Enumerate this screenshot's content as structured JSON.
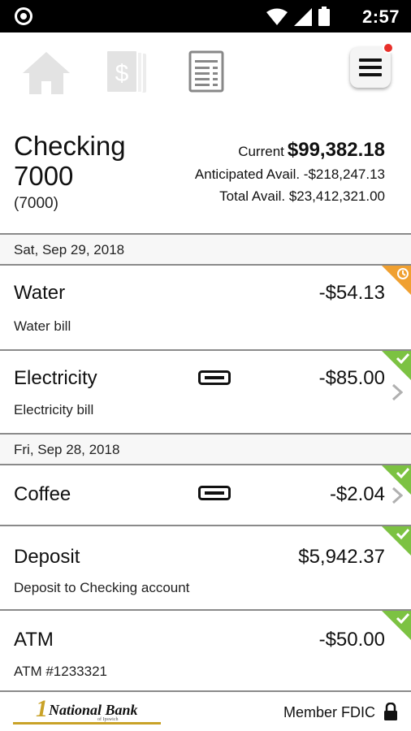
{
  "status_bar": {
    "time": "2:57",
    "icons": [
      "screen-record-icon",
      "wifi-icon",
      "cell-signal-icon",
      "battery-icon"
    ]
  },
  "nav": {
    "icons": [
      "home-icon",
      "money-icon",
      "statements-icon",
      "menu-icon"
    ],
    "menu_has_notification": true,
    "notification_color": "#e8302a"
  },
  "account": {
    "name": "Checking 7000",
    "number": "(7000)",
    "current_label": "Current",
    "current_amount": "$99,382.18",
    "anticipated_text": "Anticipated Avail. -$218,247.13",
    "total_text": "Total Avail. $23,412,321.00"
  },
  "groups": [
    {
      "date": "Sat, Sep 29, 2018",
      "transactions": [
        {
          "title": "Water",
          "amount": "-$54.13",
          "description": "Water bill",
          "status": "pending",
          "status_color": "#f0a030",
          "card": false,
          "chevron": false
        },
        {
          "title": "Electricity",
          "amount": "-$85.00",
          "description": "Electricity bill",
          "status": "cleared",
          "status_color": "#7cc242",
          "card": true,
          "chevron": true
        }
      ]
    },
    {
      "date": "Fri, Sep 28, 2018",
      "transactions": [
        {
          "title": "Coffee",
          "amount": "-$2.04",
          "description": "",
          "status": "cleared",
          "status_color": "#7cc242",
          "card": true,
          "chevron": true
        },
        {
          "title": "Deposit",
          "amount": "$5,942.37",
          "description": "Deposit to Checking account",
          "status": "cleared",
          "status_color": "#7cc242",
          "card": false,
          "chevron": false
        },
        {
          "title": "ATM",
          "amount": "-$50.00",
          "description": "ATM #1233321",
          "status": "cleared",
          "status_color": "#7cc242",
          "card": false,
          "chevron": false
        }
      ]
    }
  ],
  "footer": {
    "logo_text": "1st National Bank",
    "logo_subtext": "of Ipswich",
    "member_text": "Member FDIC"
  }
}
